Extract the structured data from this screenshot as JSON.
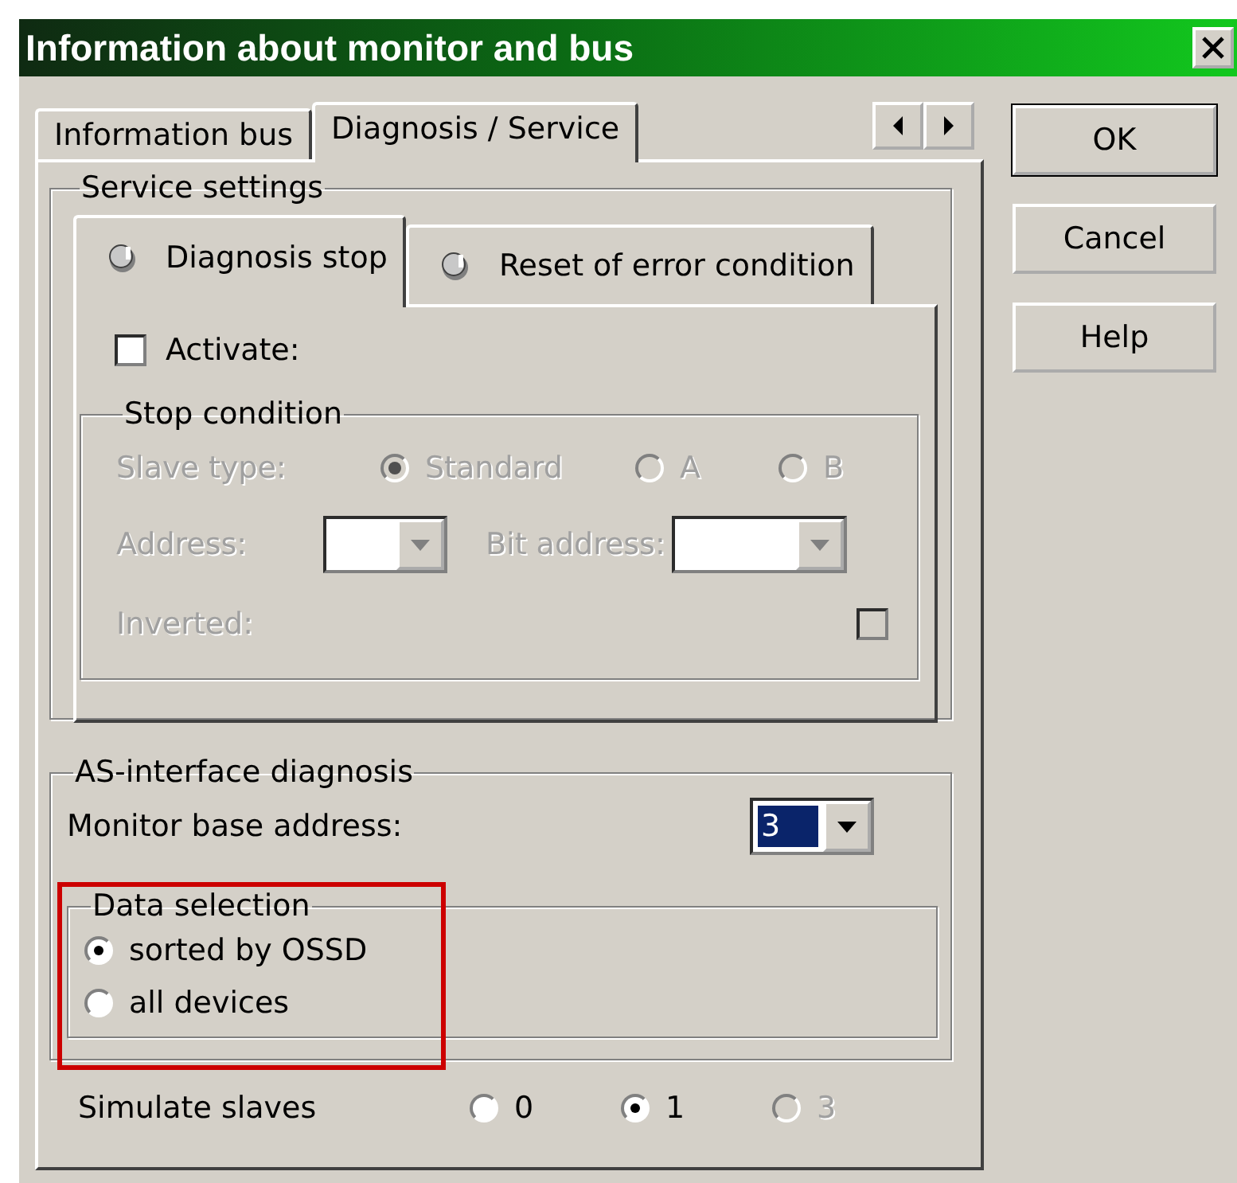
{
  "window": {
    "title": "Information about monitor and bus"
  },
  "tabs": [
    {
      "label": "Information bus",
      "selected": false
    },
    {
      "label": "Diagnosis / Service",
      "selected": true
    }
  ],
  "buttons": [
    {
      "label": "OK",
      "default": true
    },
    {
      "label": "Cancel",
      "default": false
    },
    {
      "label": "Help",
      "default": false
    }
  ],
  "service_settings": {
    "title": "Service settings",
    "tabs": [
      {
        "label": "Diagnosis stop",
        "selected": true
      },
      {
        "label": "Reset of error condition",
        "selected": false
      }
    ],
    "activate": {
      "label": "Activate:",
      "checked": false
    },
    "stop_condition": {
      "title": "Stop condition",
      "disabled": true,
      "slave_type": {
        "label": "Slave type:",
        "options": [
          {
            "label": "Standard",
            "selected": true
          },
          {
            "label": "A",
            "selected": false
          },
          {
            "label": "B",
            "selected": false
          }
        ]
      },
      "address": {
        "label": "Address:"
      },
      "bit_address": {
        "label": "Bit address:"
      },
      "inverted": {
        "label": "Inverted:",
        "checked": false
      }
    }
  },
  "as_interface": {
    "title": "AS-interface diagnosis",
    "monitor_base_address": {
      "label": "Monitor base address:",
      "value": "3"
    },
    "data_selection": {
      "title": "Data selection",
      "options": [
        {
          "label": "sorted by OSSD",
          "selected": true
        },
        {
          "label": "all devices",
          "selected": false
        }
      ]
    }
  },
  "simulate_slaves": {
    "label": "Simulate slaves",
    "options": [
      {
        "label": "0",
        "selected": false,
        "disabled": false
      },
      {
        "label": "1",
        "selected": true,
        "disabled": false
      },
      {
        "label": "3",
        "selected": false,
        "disabled": true
      }
    ]
  }
}
